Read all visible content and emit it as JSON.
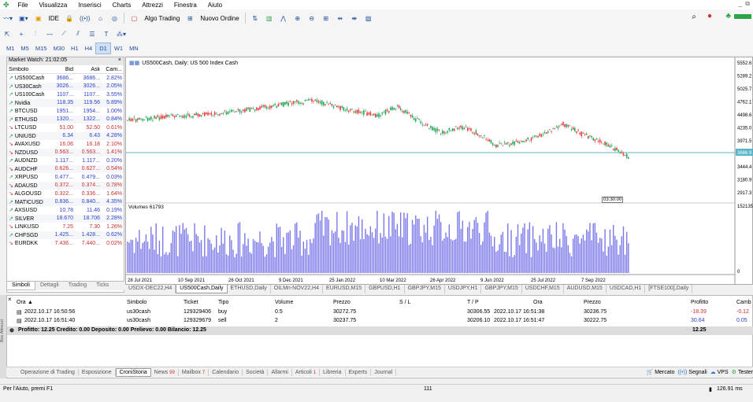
{
  "menu": [
    "File",
    "Visualizza",
    "Inserisci",
    "Charts",
    "Attrezzi",
    "Finestra",
    "Aiuto"
  ],
  "toolbar": {
    "ide": "IDE",
    "algo_trading": "Algo Trading",
    "new_order": "Nuovo Ordine"
  },
  "timeframes": [
    "M1",
    "M5",
    "M15",
    "M30",
    "H1",
    "H4",
    "D1",
    "W1",
    "MN"
  ],
  "active_timeframe": "D1",
  "market_watch": {
    "title": "Market Watch: 21:02:05",
    "col_symbol": "Simbolo",
    "col_bid": "Bid",
    "col_ask": "Ask",
    "col_change": "Cam...",
    "rows": [
      {
        "symbol": "US500Cash",
        "bid": "3686...",
        "ask": "3686...",
        "change": "2.82%",
        "dir": "up"
      },
      {
        "symbol": "US30Cash",
        "bid": "3026...",
        "ask": "3026...",
        "change": "2.05%",
        "dir": "up"
      },
      {
        "symbol": "US100Cash",
        "bid": "1107...",
        "ask": "1107...",
        "change": "3.55%",
        "dir": "up"
      },
      {
        "symbol": "Nvidia",
        "bid": "118.35",
        "ask": "119.56",
        "change": "5.89%",
        "dir": "up"
      },
      {
        "symbol": "BTCUSD",
        "bid": "1951...",
        "ask": "1954...",
        "change": "1.00%",
        "dir": "up"
      },
      {
        "symbol": "ETHUSD",
        "bid": "1320...",
        "ask": "1322...",
        "change": "0.84%",
        "dir": "up"
      },
      {
        "symbol": "LTCUSD",
        "bid": "51.00",
        "ask": "52.50",
        "change": "0.61%",
        "dir": "down"
      },
      {
        "symbol": "UNIUSD",
        "bid": "6.34",
        "ask": "6.43",
        "change": "4.28%",
        "dir": "up"
      },
      {
        "symbol": "AVAXUSD",
        "bid": "16.06",
        "ask": "16.18",
        "change": "2.10%",
        "dir": "down"
      },
      {
        "symbol": "NZDUSD",
        "bid": "0.563...",
        "ask": "0.563...",
        "change": "1.41%",
        "dir": "down"
      },
      {
        "symbol": "AUDNZD",
        "bid": "1.117...",
        "ask": "1.117...",
        "change": "0.20%",
        "dir": "up"
      },
      {
        "symbol": "AUDCHF",
        "bid": "0.626...",
        "ask": "0.627...",
        "change": "0.54%",
        "dir": "down"
      },
      {
        "symbol": "XRPUSD",
        "bid": "0.477...",
        "ask": "0.479...",
        "change": "0.03%",
        "dir": "up"
      },
      {
        "symbol": "ADAUSD",
        "bid": "0.372...",
        "ask": "0.374...",
        "change": "0.78%",
        "dir": "down"
      },
      {
        "symbol": "ALGOUSD",
        "bid": "0.322...",
        "ask": "0.336...",
        "change": "1.64%",
        "dir": "down"
      },
      {
        "symbol": "MATICUSD",
        "bid": "0.836...",
        "ask": "0.840...",
        "change": "4.35%",
        "dir": "up"
      },
      {
        "symbol": "AXSUSD",
        "bid": "10.78",
        "ask": "11.46",
        "change": "0.19%",
        "dir": "up"
      },
      {
        "symbol": "SILVER",
        "bid": "18.670",
        "ask": "18.706",
        "change": "2.28%",
        "dir": "up"
      },
      {
        "symbol": "LINKUSD",
        "bid": "7.25",
        "ask": "7.30",
        "change": "1.26%",
        "dir": "down"
      },
      {
        "symbol": "CHFSGD",
        "bid": "1.425...",
        "ask": "1.428...",
        "change": "0.62%",
        "dir": "up"
      },
      {
        "symbol": "EURDKK",
        "bid": "7.436...",
        "ask": "7.440...",
        "change": "0.02%",
        "dir": "down"
      }
    ],
    "tabs": [
      "Simboli",
      "Dettagli",
      "Trading",
      "Ticks"
    ]
  },
  "chart": {
    "legend": "US500Cash, Daily:  US 500 Index Cash",
    "volume_label": "Volumes 61793",
    "price_ticks": [
      "5552.6",
      "5289.2",
      "5025.7",
      "4762.1",
      "4498.6",
      "4235.0",
      "3971.5",
      "3686.9",
      "3444.4",
      "3180.9",
      "2917.3"
    ],
    "volume_tick": "152135",
    "volume_zero": "0",
    "current_label": "03:30:00",
    "date_ticks": [
      "28 Jul 2021",
      "10 Sep 2021",
      "26 Oct 2021",
      "9 Dec 2021",
      "25 Jan 2022",
      "10 Mar 2022",
      "26 Apr 2022",
      "9 Jun 2022",
      "25 Jul 2022",
      "7 Sep 2022"
    ],
    "colors": {
      "up": "#26a65b",
      "down": "#e23b3b",
      "volume": "#7b78e8",
      "price_line": "#5ab4c8"
    }
  },
  "chart_tabs": [
    "USDX-DEC22,H4",
    "US500Cash,Daily",
    "ETHUSD,Daily",
    "OILMn-NOV22,H4",
    "EURUSD,M15",
    "GBPUSD,H1",
    "GBPJPY,M15",
    "USDJPY,H1",
    "GBPJPY,M15",
    "USDCHF,M15",
    "AUDUSD,M15",
    "USDCAD,H1",
    "[FTSE100],Daily"
  ],
  "active_chart_tab": "US500Cash,Daily",
  "terminal": {
    "headers": {
      "time": "Ora",
      "symbol": "Simbolo",
      "ticket": "Ticket",
      "type": "Tipo",
      "volume": "Volume",
      "price": "Prezzo",
      "sl": "S / L",
      "tp": "T / P",
      "time2": "Ora",
      "price2": "Prezzo",
      "profit": "Profitto",
      "swap": "Camb"
    },
    "rows": [
      {
        "time": "2022.10.17 16:50:56",
        "symbol": "us30cash",
        "ticket": "129329406",
        "type": "buy",
        "volume": "0.5",
        "price": "30272.75",
        "sl": "",
        "tp": "30306.55",
        "time2": "2022.10.17 16:51:38",
        "price2": "30236.75",
        "profit": "-18.39",
        "swap": "-0.12"
      },
      {
        "time": "2022.10.17 16:51:40",
        "symbol": "us30cash",
        "ticket": "129329679",
        "type": "sell",
        "volume": "2",
        "price": "30237.75",
        "sl": "",
        "tp": "30206.10",
        "time2": "2022.10.17 16:51:47",
        "price2": "30222.75",
        "profit": "30.64",
        "swap": "0.05"
      }
    ],
    "summary": "Profitto: 12.25  Credito: 0.00  Deposito: 0.00  Prelievo: 0.00  Bilancio: 12.25",
    "summary_profit": "12.25",
    "side_label": "Box Attrezzi",
    "tabs": [
      "Operazione di Trading",
      "Esposizione",
      "CroniStoria",
      "News",
      "Mailbox",
      "Calendario",
      "Società",
      "Allarmi",
      "Articoli",
      "Libreria",
      "Experts",
      "Journal"
    ],
    "news_badge": "99",
    "mailbox_badge": "7",
    "articles_badge": "1",
    "active_tab": "CroniStoria",
    "right_links": {
      "market": "Mercato",
      "signals": "Segnali",
      "vps": "VPS",
      "tester": "Tester"
    }
  },
  "status": {
    "help": "Per l'Aiuto, premi F1",
    "value": "111",
    "ping": "126.91 ms"
  }
}
